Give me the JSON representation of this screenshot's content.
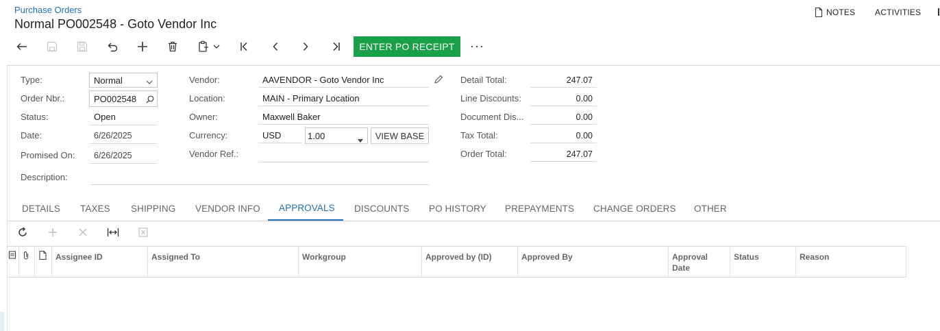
{
  "header": {
    "breadcrumb": "Purchase Orders",
    "title": "Normal PO002548 - Goto Vendor Inc",
    "notes_label": "NOTES",
    "activities_label": "ACTIVITIES"
  },
  "toolbar": {
    "enter_po_receipt_label": "ENTER PO RECEIPT",
    "more_label": "···",
    "accent_color": "#1ba04a"
  },
  "form": {
    "type_label": "Type:",
    "type_value": "Normal",
    "order_nbr_label": "Order Nbr.:",
    "order_nbr_value": "PO002548",
    "status_label": "Status:",
    "status_value": "Open",
    "date_label": "Date:",
    "date_value": "6/26/2025",
    "promised_on_label": "Promised On:",
    "promised_on_value": "6/26/2025",
    "description_label": "Description:",
    "description_value": "",
    "vendor_label": "Vendor:",
    "vendor_value": "AAVENDOR - Goto Vendor Inc",
    "location_label": "Location:",
    "location_value": "MAIN - Primary Location",
    "owner_label": "Owner:",
    "owner_value": "Maxwell Baker",
    "currency_label": "Currency:",
    "currency_value": "USD",
    "rate_value": "1.00",
    "view_base_label": "VIEW BASE",
    "vendor_ref_label": "Vendor Ref.:",
    "vendor_ref_value": "",
    "detail_total_label": "Detail Total:",
    "detail_total_value": "247.07",
    "line_discounts_label": "Line Discounts:",
    "line_discounts_value": "0.00",
    "document_dis_label": "Document Dis...",
    "document_dis_value": "0.00",
    "tax_total_label": "Tax Total:",
    "tax_total_value": "0.00",
    "order_total_label": "Order Total:",
    "order_total_value": "247.07"
  },
  "tabs": [
    "DETAILS",
    "TAXES",
    "SHIPPING",
    "VENDOR INFO",
    "APPROVALS",
    "DISCOUNTS",
    "PO HISTORY",
    "PREPAYMENTS",
    "CHANGE ORDERS",
    "OTHER"
  ],
  "active_tab": "APPROVALS",
  "grid": {
    "columns": [
      "Assignee ID",
      "Assigned To",
      "Workgroup",
      "Approved by (ID)",
      "Approved By",
      "Approval Date",
      "Status",
      "Reason"
    ]
  }
}
